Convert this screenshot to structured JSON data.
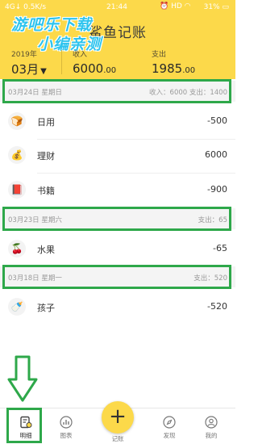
{
  "status_bar": {
    "left": "4G↓ 0.5K/s",
    "time": "21:44",
    "hd": "HD",
    "battery": "31%"
  },
  "header": {
    "title": "鲨鱼记账",
    "watermark_line1": "游吧乐下载",
    "watermark_line2": "小编亲测",
    "year": "2019年",
    "month": "03月",
    "income_label": "收入",
    "income_int": "6000",
    "income_dec": ".00",
    "expense_label": "支出",
    "expense_int": "1985",
    "expense_dec": ".00",
    "accent_color": "#fcd94a"
  },
  "days": [
    {
      "date": "03月24日 星期日",
      "summary": "收入：6000    支出：1400",
      "entries": [
        {
          "icon": "bread-icon",
          "glyph": "🍞",
          "category": "日用",
          "amount": "-500"
        },
        {
          "icon": "money-bag-icon",
          "glyph": "💰",
          "category": "理财",
          "amount": "6000"
        },
        {
          "icon": "book-icon",
          "glyph": "📕",
          "category": "书籍",
          "amount": "-900"
        }
      ]
    },
    {
      "date": "03月23日 星期六",
      "summary": "支出：65",
      "entries": [
        {
          "icon": "cherry-icon",
          "glyph": "🍒",
          "category": "水果",
          "amount": "-65"
        }
      ]
    },
    {
      "date": "03月18日 星期一",
      "summary": "支出：520",
      "entries": [
        {
          "icon": "baby-bottle-icon",
          "glyph": "🍼",
          "category": "孩子",
          "amount": "-520"
        }
      ]
    }
  ],
  "tabbar": {
    "tabs": [
      "明细",
      "图表",
      "记账",
      "发现",
      "我的"
    ],
    "add_symbol": "+"
  },
  "annotation_color": "#2ea84a"
}
